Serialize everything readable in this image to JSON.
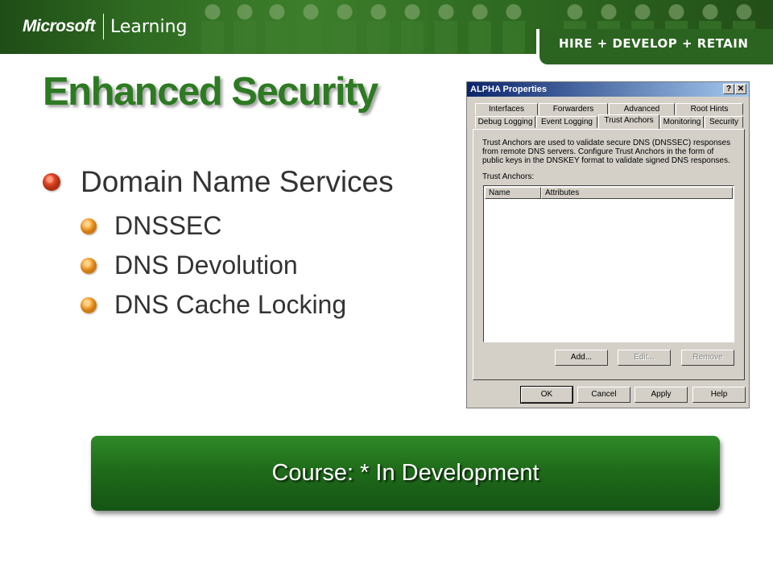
{
  "header": {
    "logo_brand": "Microsoft",
    "logo_product": "Learning",
    "tagline": "HIRE + DEVELOP + RETAIN",
    "colors": {
      "banner": "#2f6b22",
      "accent": "#2d7a22"
    }
  },
  "slide": {
    "title": "Enhanced Security",
    "bullets": [
      {
        "text": "Domain Name Services",
        "level": 1
      },
      {
        "text": "DNSSEC",
        "level": 2
      },
      {
        "text": "DNS Devolution",
        "level": 2
      },
      {
        "text": "DNS Cache Locking",
        "level": 2
      }
    ]
  },
  "dialog": {
    "title": "ALPHA Properties",
    "help_button": "?",
    "close_button": "✕",
    "tabs_row1": [
      "Interfaces",
      "Forwarders",
      "Advanced",
      "Root Hints"
    ],
    "tabs_row2": [
      "Debug Logging",
      "Event Logging",
      "Trust Anchors",
      "Monitoring",
      "Security"
    ],
    "active_tab": "Trust Anchors",
    "description": "Trust Anchors are used to validate secure DNS (DNSSEC) responses from remote DNS servers. Configure Trust Anchors in the form of public keys in the DNSKEY format to validate signed DNS responses.",
    "list_label": "Trust Anchors:",
    "columns": [
      "Name",
      "Attributes"
    ],
    "rows": [],
    "list_buttons": [
      {
        "label": "Add...",
        "enabled": true
      },
      {
        "label": "Edit...",
        "enabled": false
      },
      {
        "label": "Remove",
        "enabled": false
      }
    ],
    "footer_buttons": [
      "OK",
      "Cancel",
      "Apply",
      "Help"
    ]
  },
  "course_bar": {
    "text": "Course: * In Development"
  }
}
